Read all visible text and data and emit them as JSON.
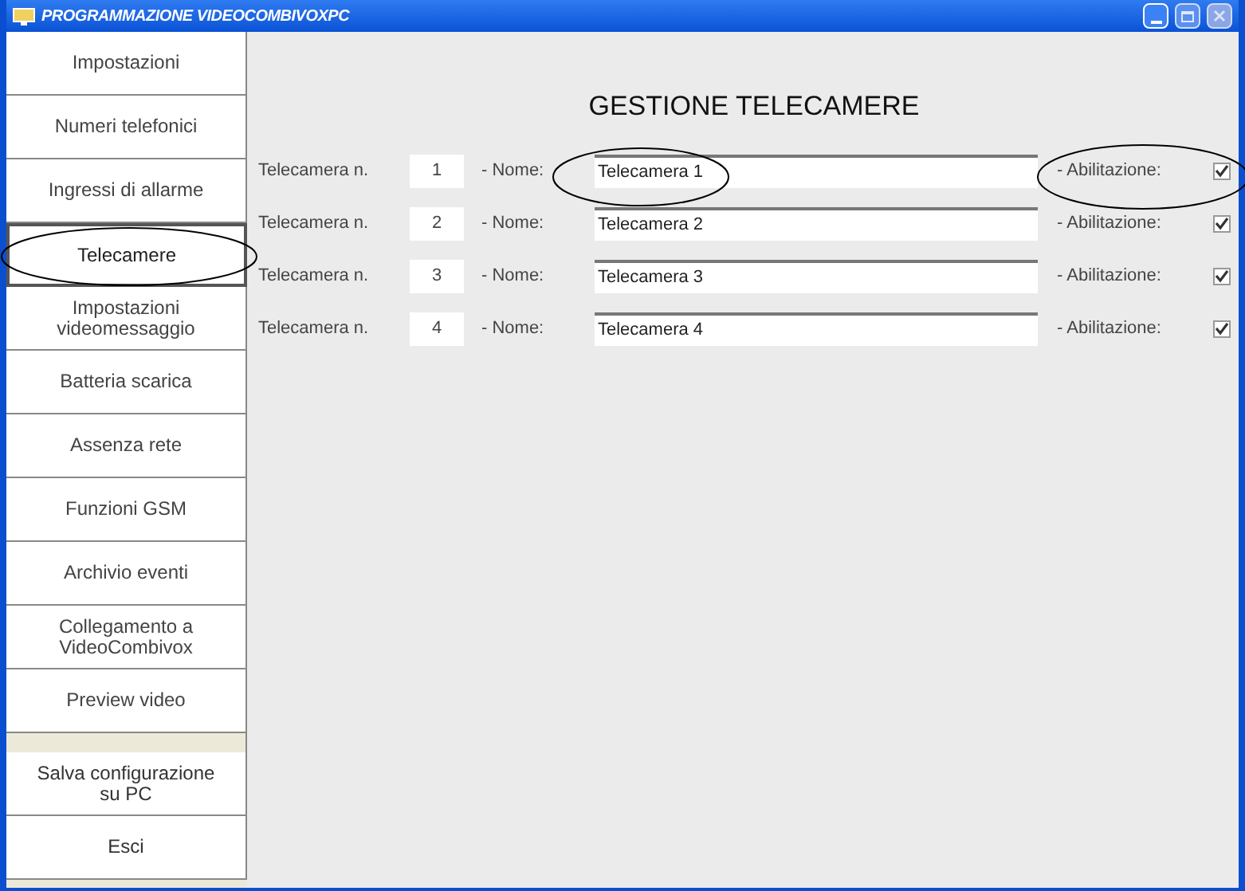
{
  "window": {
    "title": "PROGRAMMAZIONE VIDEOCOMBIVOXPC"
  },
  "sidebar": {
    "items": [
      {
        "label": "Impostazioni",
        "selected": false
      },
      {
        "label": "Numeri telefonici",
        "selected": false
      },
      {
        "label": "Ingressi di allarme",
        "selected": false
      },
      {
        "label": "Telecamere",
        "selected": true
      },
      {
        "label": "Impostazioni videomessaggio",
        "selected": false
      },
      {
        "label": "Batteria scarica",
        "selected": false
      },
      {
        "label": "Assenza rete",
        "selected": false
      },
      {
        "label": "Funzioni GSM",
        "selected": false
      },
      {
        "label": "Archivio eventi",
        "selected": false
      },
      {
        "label": "Collegamento a VideoCombivox",
        "selected": false
      },
      {
        "label": "Preview video",
        "selected": false
      }
    ],
    "actions": [
      "Salva configurazione su PC",
      "Esci"
    ]
  },
  "heading": "GESTIONE TELECAMERE",
  "cameras": [
    {
      "label": "Telecamera n.",
      "number": "1",
      "name_label": "- Nome:",
      "name": "Telecamera 1",
      "enable_label": "- Abilitazione:",
      "checked": true
    },
    {
      "label": "Telecamera n.",
      "number": "2",
      "name_label": "- Nome:",
      "name": "Telecamera 2",
      "enable_label": "- Abilitazione:",
      "checked": true
    },
    {
      "label": "Telecamera n.",
      "number": "3",
      "name_label": "- Nome:",
      "name": "Telecamera 3",
      "enable_label": "- Abilitazione:",
      "checked": true
    },
    {
      "label": "Telecamera n.",
      "number": "4",
      "name_label": "- Nome:",
      "name": "Telecamera 4",
      "enable_label": "- Abilitazione:",
      "checked": true
    }
  ]
}
